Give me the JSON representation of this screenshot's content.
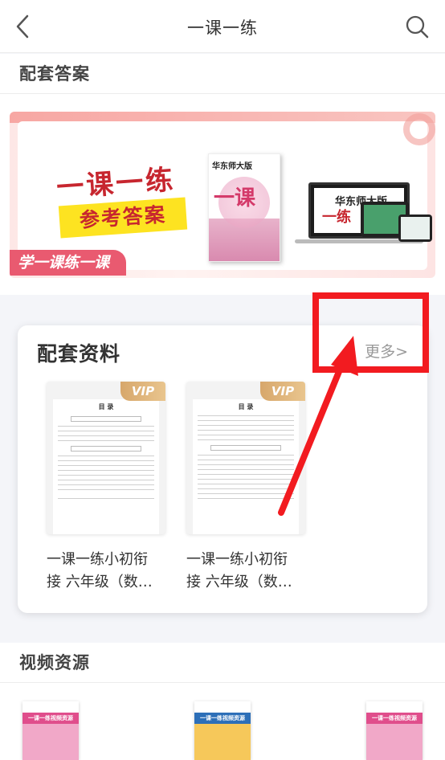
{
  "header": {
    "title": "一课一练"
  },
  "answer_section": {
    "title": "配套答案",
    "banner": {
      "title": "一课一练",
      "subtitle": "参考答案",
      "ribbon": "学一课练一课",
      "publisher": "华东师大版",
      "book_title": "一课",
      "book_title2": "一练"
    }
  },
  "materials": {
    "title": "配套资料",
    "more": "更多>",
    "items": [
      {
        "label_line1": "一课一练小初衔",
        "label_line2": "接 六年级（数…",
        "badge": "VIP",
        "doc_title": "目 录"
      },
      {
        "label_line1": "一课一练小初衔",
        "label_line2": "接 六年级（数…",
        "badge": "VIP",
        "doc_title": "目 录"
      }
    ]
  },
  "video_section": {
    "title": "视频资源",
    "items": [
      {
        "name": "一课一练视频资源"
      },
      {
        "name": "一课一练视频资源"
      },
      {
        "name": "一课一练视频资源"
      }
    ]
  },
  "colors": {
    "annotation": "#f21b20",
    "brand_red": "#c7262f",
    "vip_gold": "#d7a76b"
  }
}
